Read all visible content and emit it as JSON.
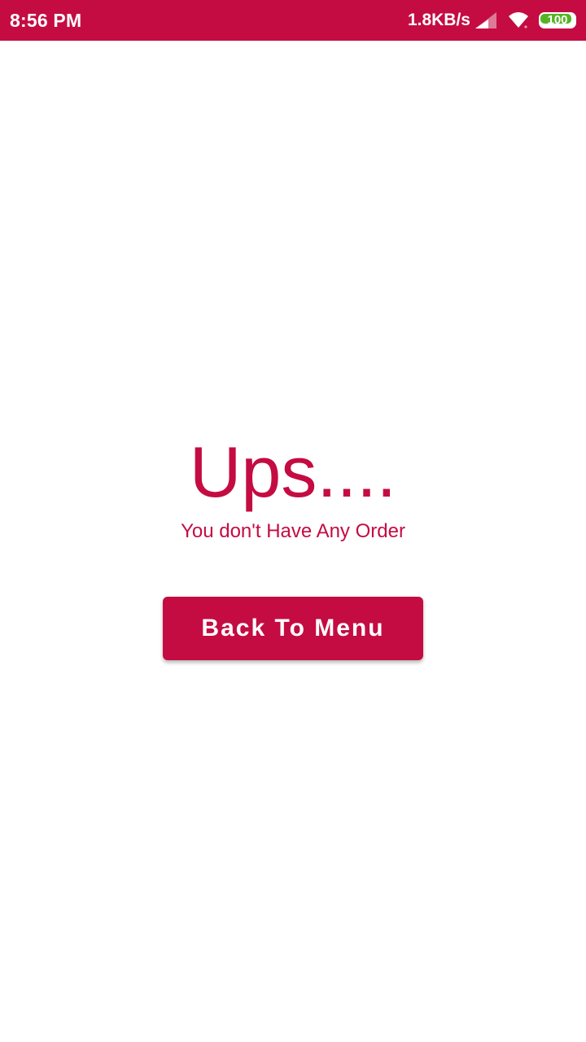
{
  "status_bar": {
    "time": "8:56 PM",
    "net_speed": "1.8KB/s",
    "battery_level": "100",
    "icons": [
      "signal-icon",
      "wifi-icon",
      "battery-icon"
    ]
  },
  "empty_state": {
    "headline": "Ups....",
    "message": "You don't Have Any Order"
  },
  "actions": {
    "back_to_menu_label": "Back To Menu"
  },
  "colors": {
    "primary": "#c40c42",
    "background": "#ffffff",
    "battery_fill": "#54b324"
  }
}
